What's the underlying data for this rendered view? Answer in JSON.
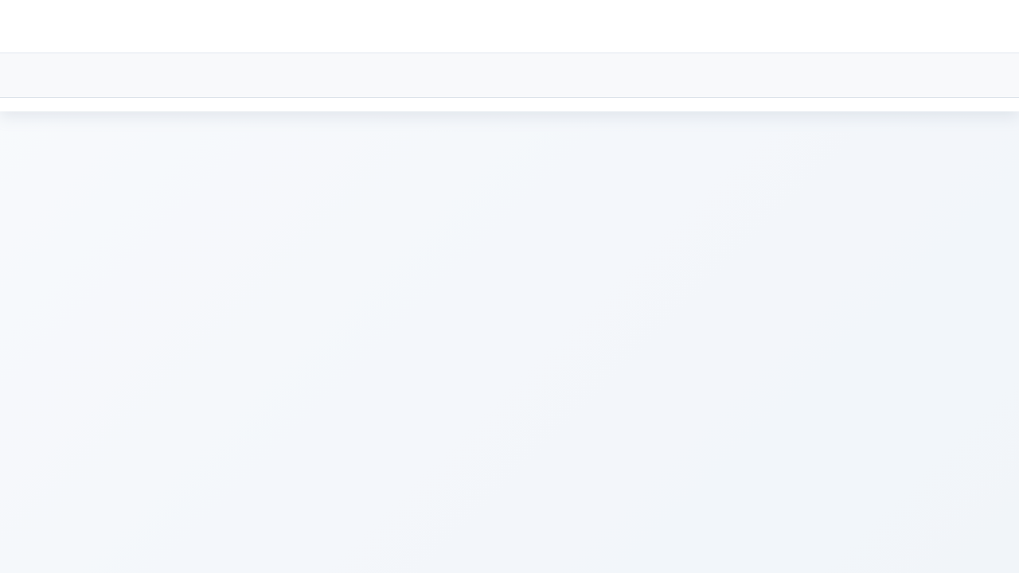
{
  "app": {
    "header": {},
    "toolbar": {},
    "content": {}
  }
}
